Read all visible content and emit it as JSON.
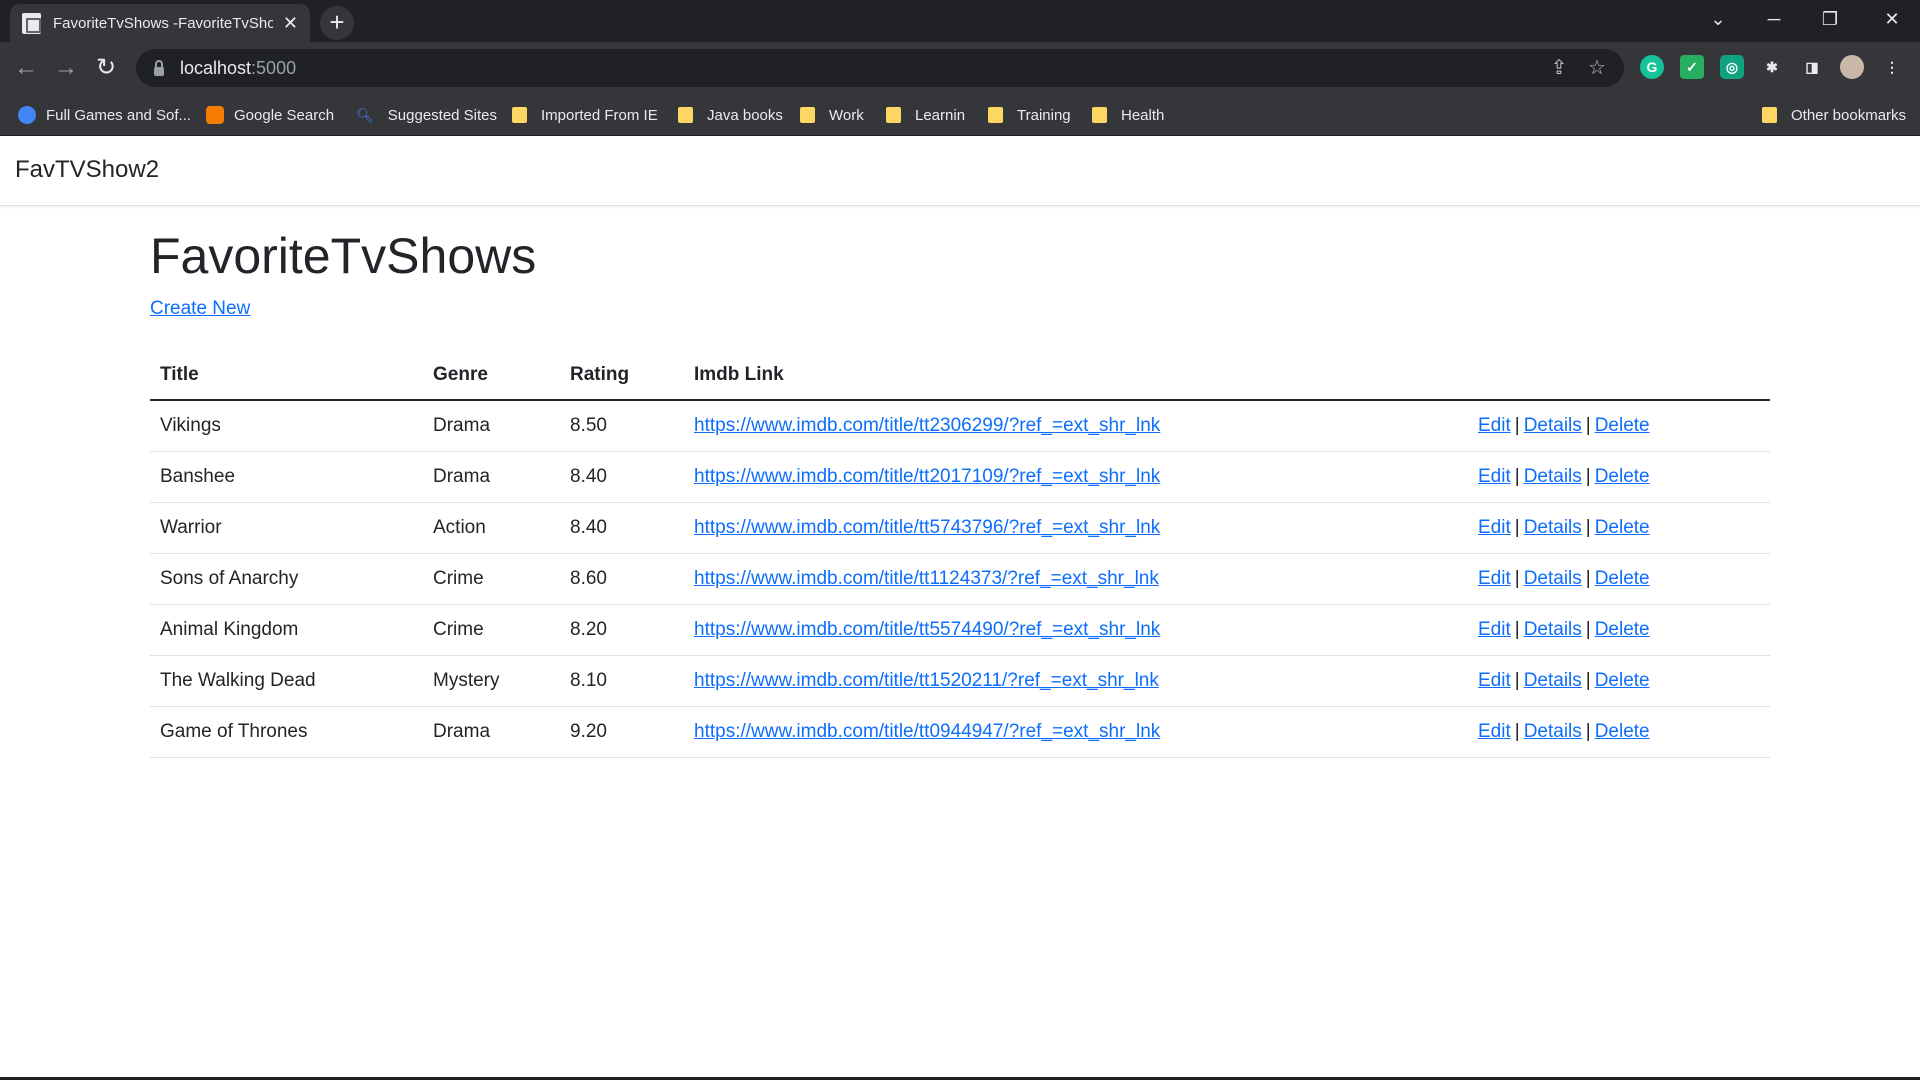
{
  "browser": {
    "tab_title": "FavoriteTvShows -FavoriteTvShow",
    "tab_close": "✕",
    "new_tab": "+",
    "url_host": "localhost",
    "url_port": ":5000",
    "bookmarks": [
      {
        "label": "Full Games and Sof...",
        "icon": "globe-icon",
        "color": "#4285f4"
      },
      {
        "label": "Google Search",
        "icon": "blogger-icon",
        "color": "#f57c00"
      },
      {
        "label": "Suggested Sites",
        "icon": "search-icon",
        "color": "#4285f4"
      },
      {
        "label": "Imported From IE",
        "icon": "folder-icon"
      },
      {
        "label": "Java books",
        "icon": "folder-icon"
      },
      {
        "label": "Work",
        "icon": "folder-icon"
      },
      {
        "label": "Learnin",
        "icon": "folder-icon"
      },
      {
        "label": "Training",
        "icon": "folder-icon"
      },
      {
        "label": "Health",
        "icon": "folder-icon"
      }
    ],
    "other_bookmarks": "Other bookmarks"
  },
  "app": {
    "brand": "FavTVShow2",
    "heading": "FavoriteTvShows",
    "create_new": "Create New"
  },
  "table": {
    "headers": {
      "title": "Title",
      "genre": "Genre",
      "rating": "Rating",
      "link": "Imdb Link"
    },
    "actions": {
      "edit": "Edit",
      "details": "Details",
      "delete": "Delete",
      "separator": "|"
    },
    "rows": [
      {
        "title": "Vikings",
        "genre": "Drama",
        "rating": "8.50",
        "link": "https://www.imdb.com/title/tt2306299/?ref_=ext_shr_lnk"
      },
      {
        "title": "Banshee",
        "genre": "Drama",
        "rating": "8.40",
        "link": "https://www.imdb.com/title/tt2017109/?ref_=ext_shr_lnk"
      },
      {
        "title": "Warrior",
        "genre": "Action",
        "rating": "8.40",
        "link": "https://www.imdb.com/title/tt5743796/?ref_=ext_shr_lnk"
      },
      {
        "title": "Sons of Anarchy",
        "genre": "Crime",
        "rating": "8.60",
        "link": "https://www.imdb.com/title/tt1124373/?ref_=ext_shr_lnk"
      },
      {
        "title": "Animal Kingdom",
        "genre": "Crime",
        "rating": "8.20",
        "link": "https://www.imdb.com/title/tt5574490/?ref_=ext_shr_lnk"
      },
      {
        "title": "The Walking Dead",
        "genre": "Mystery",
        "rating": "8.10",
        "link": "https://www.imdb.com/title/tt1520211/?ref_=ext_shr_lnk"
      },
      {
        "title": "Game of Thrones",
        "genre": "Drama",
        "rating": "9.20",
        "link": "https://www.imdb.com/title/tt0944947/?ref_=ext_shr_lnk"
      }
    ]
  },
  "colors": {
    "link": "#0d6efd",
    "chrome_dark": "#202124",
    "chrome_toolbar": "#35363a",
    "folder": "#fdd663"
  }
}
